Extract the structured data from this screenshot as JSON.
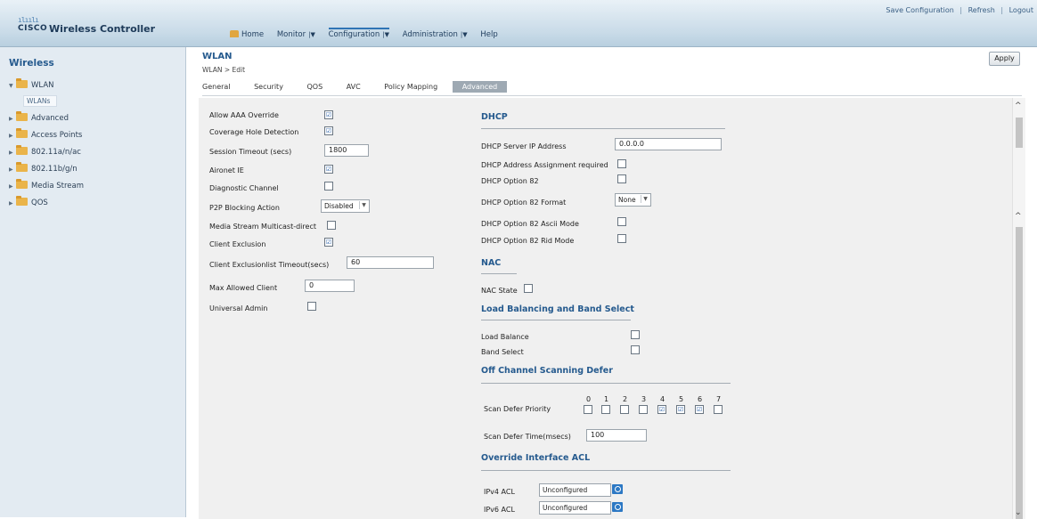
{
  "header": {
    "logo_mark": "ılıılı",
    "logo_word": "CISCO",
    "app_title": "Wireless Controller",
    "util_links": [
      "Save Configuration",
      "Refresh",
      "Logout"
    ],
    "util_sep": "|",
    "nav": {
      "home": "Home",
      "monitor": "Monitor",
      "configuration": "Configuration",
      "administration": "Administration",
      "help": "Help",
      "caret": "|▼"
    }
  },
  "sidebar": {
    "heading": "Wireless",
    "items": [
      {
        "label": "WLAN",
        "arrow": "▼"
      },
      {
        "label": "Advanced",
        "arrow": "▶"
      },
      {
        "label": "Access Points",
        "arrow": "▶"
      },
      {
        "label": "802.11a/n/ac",
        "arrow": "▶"
      },
      {
        "label": "802.11b/g/n",
        "arrow": "▶"
      },
      {
        "label": "Media Stream",
        "arrow": "▶"
      },
      {
        "label": "QOS",
        "arrow": "▶"
      }
    ],
    "sub_item": "WLANs"
  },
  "page": {
    "title": "WLAN",
    "breadcrumb": "WLAN > Edit",
    "apply": "Apply",
    "tabs": [
      "General",
      "Security",
      "QOS",
      "AVC",
      "Policy Mapping",
      "Advanced"
    ]
  },
  "left": {
    "allow_aaa": {
      "label": "Allow AAA Override",
      "checked": "☑"
    },
    "coverage_hole": {
      "label": "Coverage Hole Detection",
      "checked": "☑"
    },
    "session_timeout": {
      "label": "Session Timeout (secs)",
      "value": "1800"
    },
    "aironet": {
      "label": "Aironet IE",
      "checked": "☑"
    },
    "diag_channel": {
      "label": "Diagnostic Channel",
      "checked": ""
    },
    "p2p": {
      "label": "P2P Blocking Action",
      "value": "Disabled"
    },
    "media_stream": {
      "label": "Media Stream Multicast-direct",
      "checked": ""
    },
    "client_exclusion": {
      "label": "Client Exclusion",
      "checked": "☑"
    },
    "exclusion_timeout": {
      "label": "Client Exclusionlist Timeout(secs)",
      "value": "60"
    },
    "max_client": {
      "label": "Max Allowed Client",
      "value": "0"
    },
    "universal_admin": {
      "label": "Universal Admin",
      "checked": ""
    }
  },
  "right": {
    "dhcp": {
      "title": "DHCP",
      "server_ip": {
        "label": "DHCP Server IP Address",
        "value": "0.0.0.0"
      },
      "assignment": {
        "label": "DHCP Address Assignment required",
        "checked": ""
      },
      "opt82": {
        "label": "DHCP Option 82",
        "checked": ""
      },
      "opt82_format": {
        "label": "DHCP Option 82 Format",
        "value": "None"
      },
      "opt82_ascii": {
        "label": "DHCP Option 82 Ascii Mode",
        "checked": ""
      },
      "opt82_rid": {
        "label": "DHCP Option 82 Rid Mode",
        "checked": ""
      }
    },
    "nac": {
      "title": "NAC",
      "state": {
        "label": "NAC State",
        "checked": ""
      }
    },
    "lb": {
      "title": "Load Balancing and Band Select",
      "load_balance": {
        "label": "Load Balance",
        "checked": ""
      },
      "band_select": {
        "label": "Band Select",
        "checked": ""
      }
    },
    "ocsd": {
      "title": "Off Channel Scanning Defer",
      "priority_label": "Scan Defer Priority",
      "priorities": [
        {
          "digit": "0",
          "checked": ""
        },
        {
          "digit": "1",
          "checked": ""
        },
        {
          "digit": "2",
          "checked": ""
        },
        {
          "digit": "3",
          "checked": ""
        },
        {
          "digit": "4",
          "checked": "☑"
        },
        {
          "digit": "5",
          "checked": "☑"
        },
        {
          "digit": "6",
          "checked": "☑"
        },
        {
          "digit": "7",
          "checked": ""
        }
      ],
      "time_label": "Scan Defer Time(msecs)",
      "time_value": "100"
    },
    "acl": {
      "title": "Override Interface ACL",
      "ipv4": {
        "label": "IPv4 ACL",
        "value": "Unconfigured"
      },
      "ipv6": {
        "label": "IPv6 ACL",
        "value": "Unconfigured"
      }
    }
  },
  "scroll": {
    "up": "^",
    "down": "⌄"
  }
}
